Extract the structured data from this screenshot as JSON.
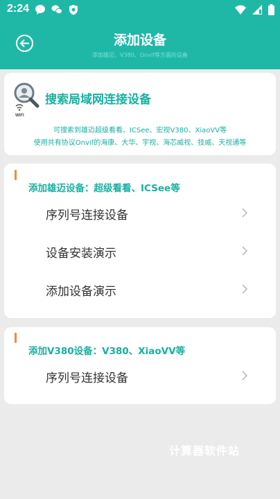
{
  "status_bar": {
    "time": "2:24",
    "left_icons": [
      "chat-bubble-icon",
      "wechat-icon",
      "shield-icon"
    ],
    "right_icons": [
      "wifi-icon",
      "signal-icon",
      "battery-icon"
    ]
  },
  "header": {
    "title": "添加设备",
    "subtitle": "添加雄迈、V380、Onvif等方面的设备",
    "accent_color": "#1fb8a7"
  },
  "search_card": {
    "icon": "search-wifi-icon",
    "title": "搜索局域网连接设备",
    "line1": "可搜索到雄迈超级看看、ICSee、宏视V380、XiaoVV等",
    "line2": "使用共有协议Onvif的海康、大华、宇视、海芯威视、技威、天视通等"
  },
  "xiongmai_section": {
    "title": "添加雄迈设备：超级看看、ICSee等",
    "items": [
      {
        "label": "序列号连接设备"
      },
      {
        "label": "设备安装演示"
      },
      {
        "label": "添加设备演示"
      }
    ]
  },
  "v380_section": {
    "title": "添加V380设备：V380、XiaoVV等",
    "items": [
      {
        "label": "序列号连接设备"
      }
    ]
  },
  "watermark": "计算器软件站"
}
